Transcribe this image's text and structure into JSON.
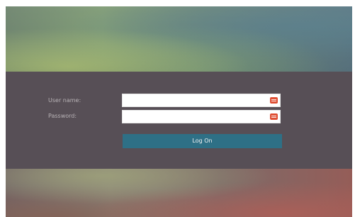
{
  "login_form": {
    "username": {
      "label": "User name:",
      "value": "",
      "placeholder": "",
      "icon": "password-manager-icon"
    },
    "password": {
      "label": "Password:",
      "value": "",
      "placeholder": "",
      "icon": "password-manager-icon"
    },
    "submit_label": "Log On"
  },
  "colors": {
    "button": "#2e7086",
    "form_band": "#574f56",
    "label_text": "#b8b3b6",
    "field_icon": "#df4f34"
  }
}
